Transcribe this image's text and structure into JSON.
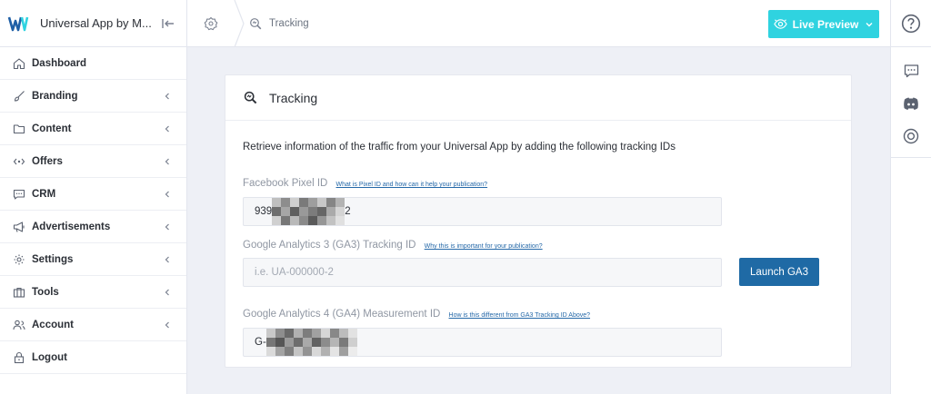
{
  "app": {
    "name": "Universal App by M...",
    "logo_icon": "brand-logo-icon"
  },
  "sidebar": {
    "items": [
      {
        "label": "Dashboard",
        "icon": "home-icon",
        "has_submenu": false
      },
      {
        "label": "Branding",
        "icon": "brush-icon",
        "has_submenu": true
      },
      {
        "label": "Content",
        "icon": "folder-icon",
        "has_submenu": true
      },
      {
        "label": "Offers",
        "icon": "tag-icon",
        "has_submenu": true
      },
      {
        "label": "CRM",
        "icon": "chat-icon",
        "has_submenu": true
      },
      {
        "label": "Advertisements",
        "icon": "megaphone-icon",
        "has_submenu": true
      },
      {
        "label": "Settings",
        "icon": "gear-icon",
        "has_submenu": true
      },
      {
        "label": "Tools",
        "icon": "briefcase-icon",
        "has_submenu": true
      },
      {
        "label": "Account",
        "icon": "users-icon",
        "has_submenu": true
      },
      {
        "label": "Logout",
        "icon": "lock-icon",
        "has_submenu": false
      }
    ]
  },
  "topbar": {
    "breadcrumb": "Tracking",
    "live_preview_label": "Live Preview",
    "accent": "#2fd3e0"
  },
  "rail": {
    "icons": [
      "help-icon",
      "comment-icon",
      "discord-icon",
      "target-icon"
    ]
  },
  "card": {
    "title": "Tracking",
    "intro": "Retrieve information of the traffic from your Universal App by adding the following tracking IDs",
    "fields": [
      {
        "label": "Facebook Pixel ID",
        "help": "What is Pixel ID and how can it help your publication?",
        "value": "939",
        "value_suffix": "2",
        "placeholder": ""
      },
      {
        "label": "Google Analytics 3 (GA3) Tracking ID",
        "help": "Why this is important for your publication?",
        "value": "",
        "placeholder": "i.e. UA-000000-2"
      },
      {
        "label": "Google Analytics 4 (GA4) Measurement ID",
        "help": "How is this different from GA3 Tracking ID Above?",
        "value": "G-",
        "placeholder": ""
      }
    ],
    "launch_button_label": "Launch GA3",
    "button_color": "#1f6aa5"
  }
}
